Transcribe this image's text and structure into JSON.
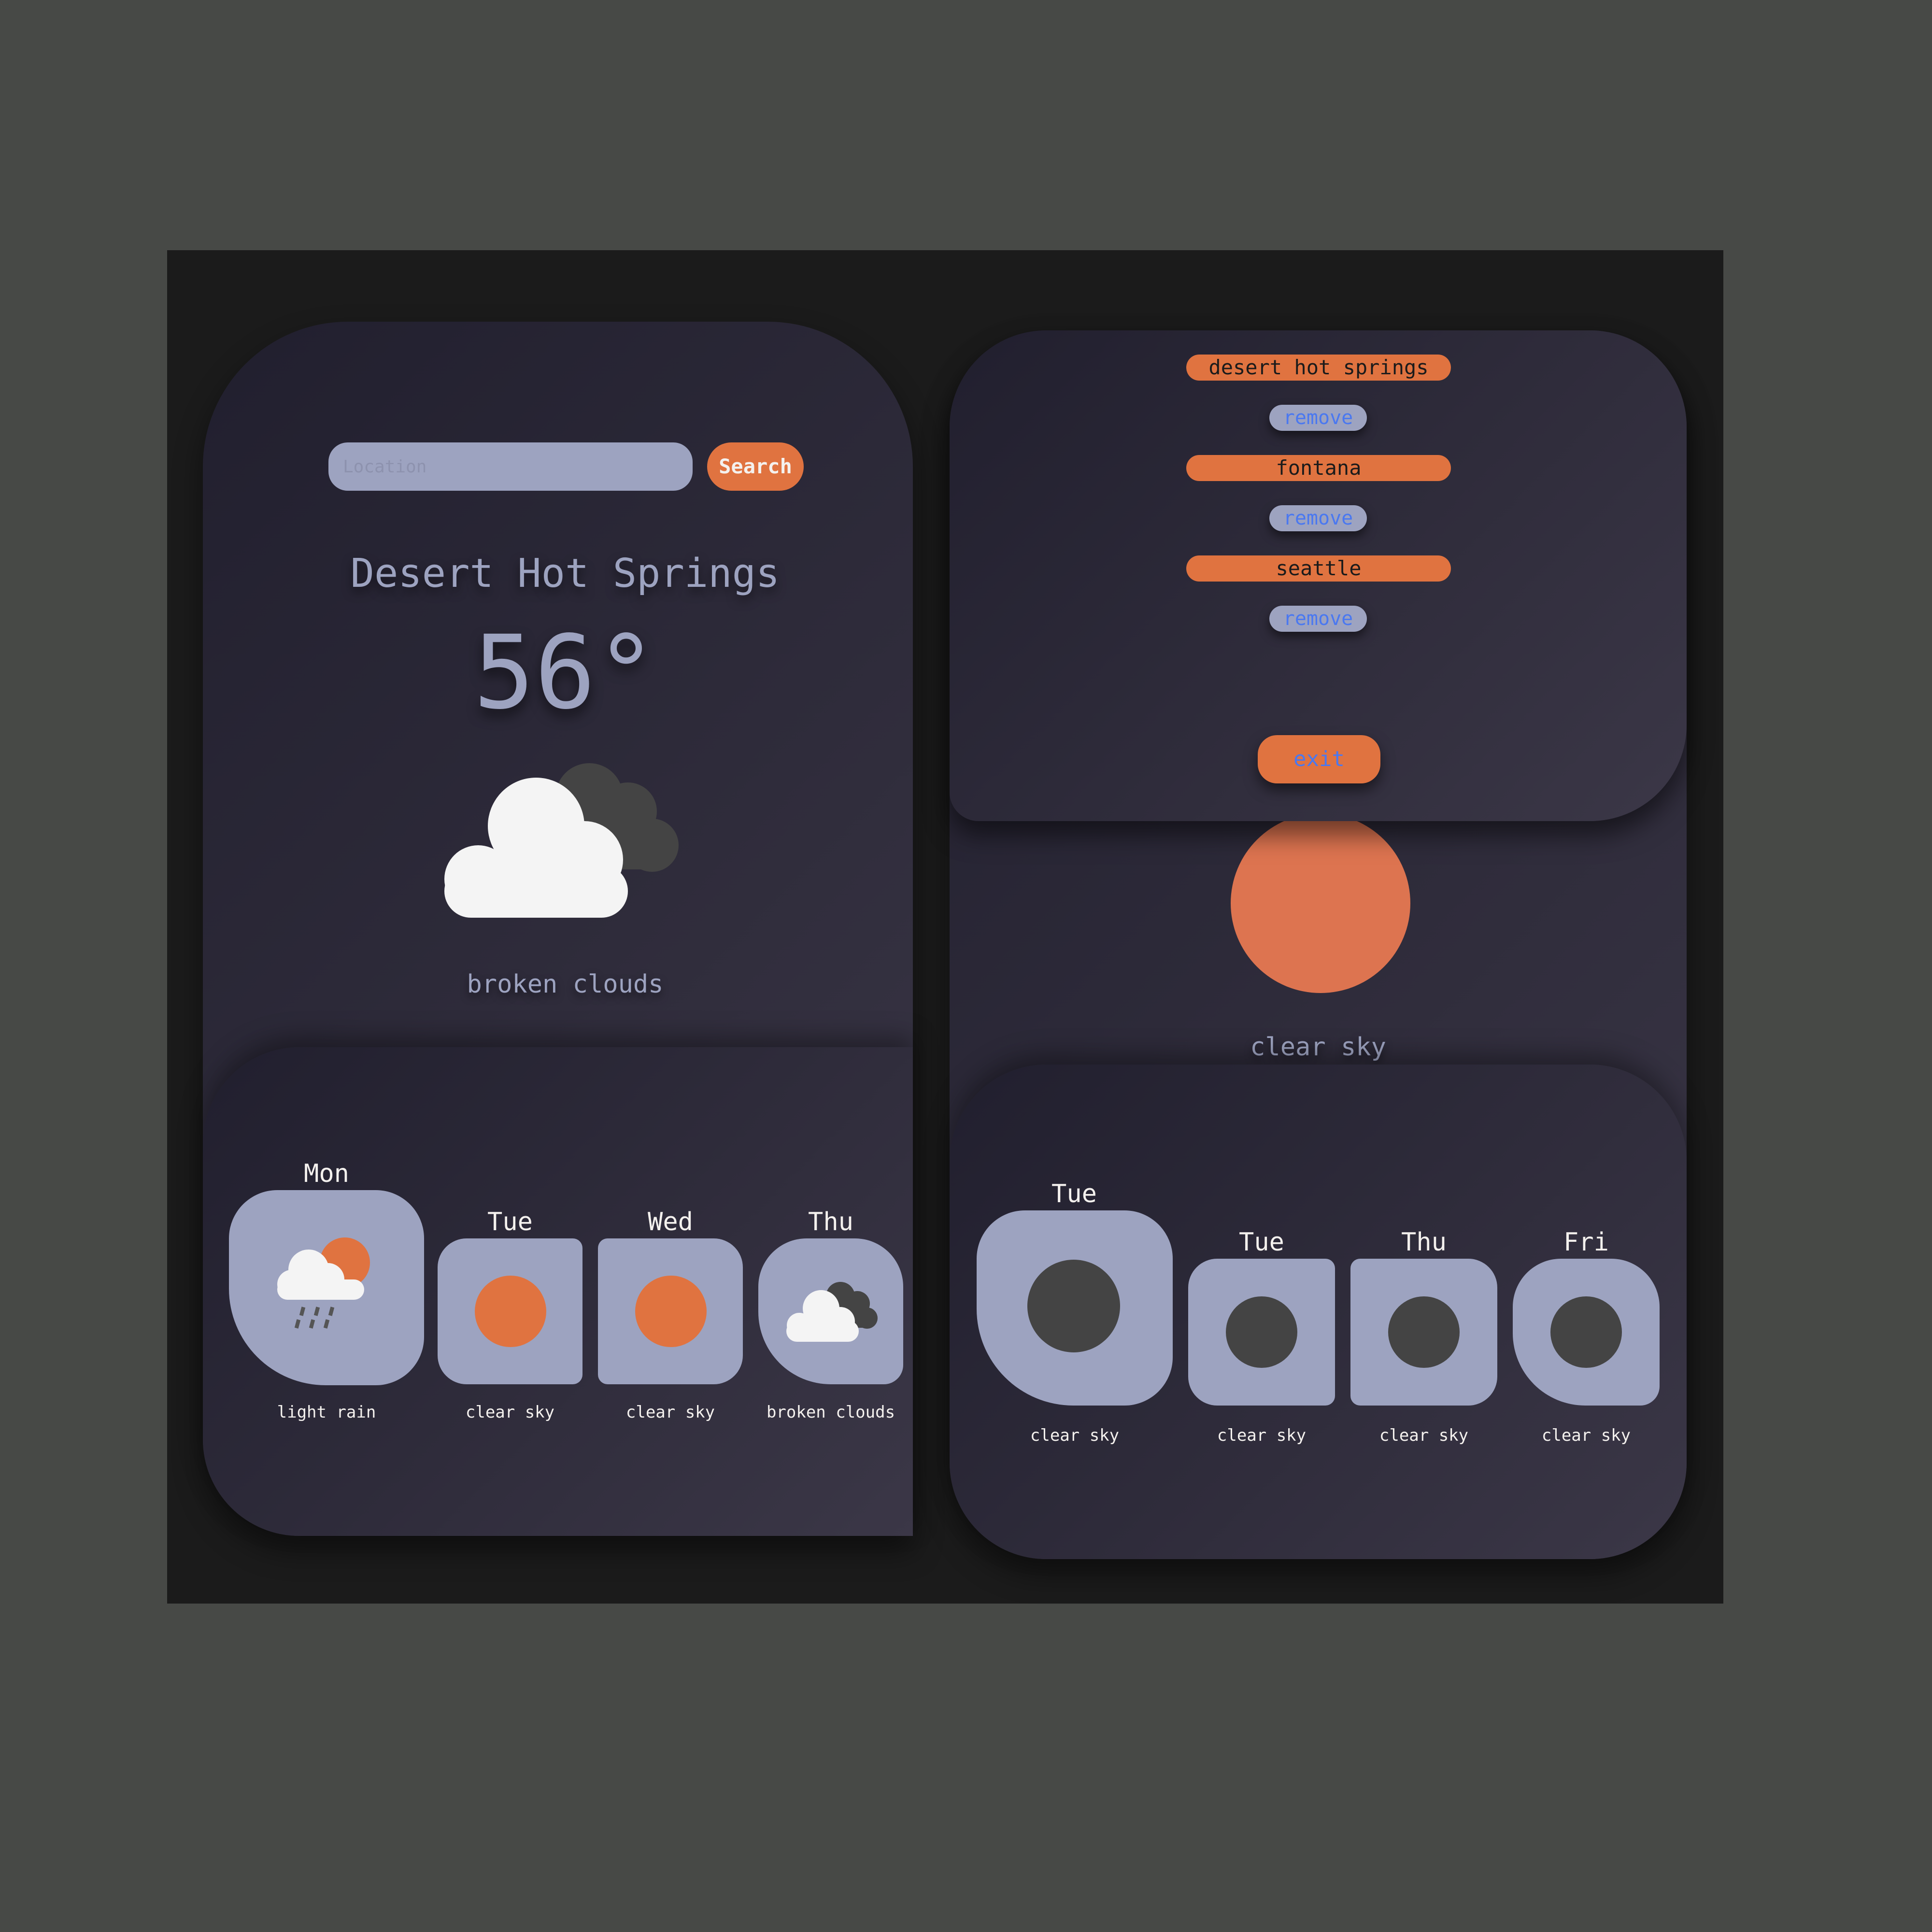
{
  "search": {
    "placeholder": "Location",
    "button_label": "Search"
  },
  "current": {
    "city": "Desert Hot Springs",
    "temperature": "56°",
    "description": "broken clouds",
    "icon": "broken-clouds-icon"
  },
  "forecast_left": [
    {
      "day": "Mon",
      "description": "light rain",
      "icon": "light-rain-icon"
    },
    {
      "day": "Tue",
      "description": "clear sky",
      "icon": "sun-icon"
    },
    {
      "day": "Wed",
      "description": "clear sky",
      "icon": "sun-icon"
    },
    {
      "day": "Thu",
      "description": "broken clouds",
      "icon": "broken-clouds-icon"
    }
  ],
  "saved": {
    "cities": [
      {
        "name": "desert hot springs",
        "remove_label": "remove"
      },
      {
        "name": "fontana",
        "remove_label": "remove"
      },
      {
        "name": "seattle",
        "remove_label": "remove"
      }
    ],
    "exit_label": "exit"
  },
  "right_current": {
    "description": "clear sky",
    "icon": "sun-icon"
  },
  "forecast_right": [
    {
      "day": "Tue",
      "description": "clear sky",
      "icon": "moon-icon"
    },
    {
      "day": "Tue",
      "description": "clear sky",
      "icon": "moon-icon"
    },
    {
      "day": "Thu",
      "description": "clear sky",
      "icon": "moon-icon"
    },
    {
      "day": "Fri",
      "description": "clear sky",
      "icon": "moon-icon"
    }
  ],
  "colors": {
    "accent": "#e07340",
    "panel_light": "#9da3c0",
    "link_blue": "#4a78f0",
    "background": "#474946"
  }
}
